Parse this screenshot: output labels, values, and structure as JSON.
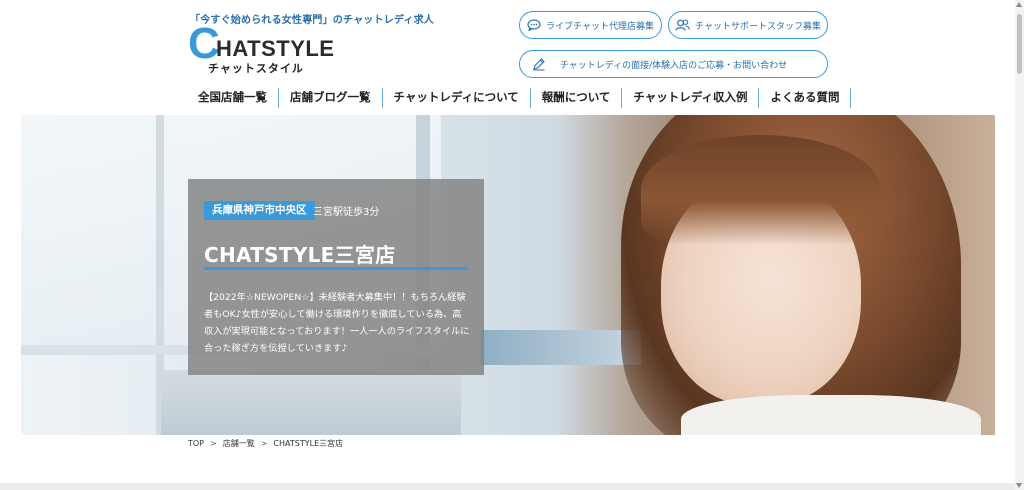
{
  "header": {
    "tagline": "「今すぐ始められる女性専門」のチャットレディ求人",
    "logo": {
      "initial": "C",
      "rest": "HATSTYLE",
      "sub": "チャットスタイル"
    },
    "buttons": {
      "agency": "ライブチャット代理店募集",
      "staff": "チャットサポートスタッフ募集",
      "contact": "チャットレディの面接/体験入店のご応募・お問い合わせ"
    }
  },
  "nav": {
    "items": [
      "全国店舗一覧",
      "店舗ブログ一覧",
      "チャットレディについて",
      "報酬について",
      "チャットレディ収入例",
      "よくある質問"
    ]
  },
  "hero": {
    "area": "兵庫県神戸市中央区",
    "access": "三宮駅徒歩3分",
    "shop_name": "CHATSTYLE三宮店",
    "description": "【2022年☆NEWOPEN☆】未経験者大募集中！！もちろん経験者もOK♪女性が安心して働ける環境作りを徹底している為、高収入が実現可能となっております！一人一人のライフスタイルに合った稼ぎ方を伝授していきます♪"
  },
  "breadcrumb": {
    "items": [
      "TOP",
      "店舗一覧",
      "CHATSTYLE三宮店"
    ],
    "separator": ">"
  },
  "colors": {
    "accent": "#3a9ad9",
    "accent_dark": "#2a6fb0",
    "text": "#222222"
  },
  "icons": {
    "agency": "chat-bubble-icon",
    "staff": "people-icon",
    "contact": "pencil-icon"
  }
}
